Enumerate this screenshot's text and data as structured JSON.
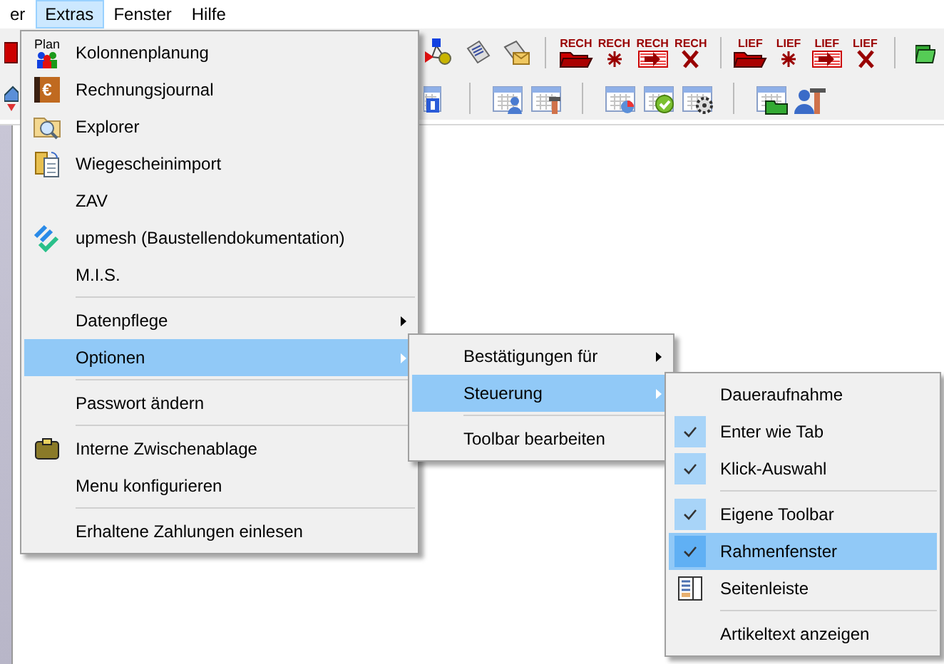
{
  "menubar": [
    {
      "label": "er",
      "selected": false
    },
    {
      "label": "Extras",
      "selected": true
    },
    {
      "label": "Fenster",
      "selected": false
    },
    {
      "label": "Hilfe",
      "selected": false
    }
  ],
  "toolbar_1": [
    {
      "kind": "red-box"
    },
    {
      "kind": "network"
    },
    {
      "kind": "document"
    },
    {
      "kind": "envelope"
    },
    {
      "kind": "separator"
    },
    {
      "kind": "folder",
      "label": "RECH"
    },
    {
      "kind": "star",
      "label": "RECH"
    },
    {
      "kind": "arrow-in",
      "label": "RECH"
    },
    {
      "kind": "cross",
      "label": "RECH"
    },
    {
      "kind": "separator"
    },
    {
      "kind": "folder",
      "label": "LIEF"
    },
    {
      "kind": "star",
      "label": "LIEF"
    },
    {
      "kind": "arrow-in",
      "label": "LIEF"
    },
    {
      "kind": "cross",
      "label": "LIEF"
    },
    {
      "kind": "separator"
    },
    {
      "kind": "green-folder"
    }
  ],
  "toolbar_2": [
    {
      "kind": "house"
    },
    {
      "kind": "calendar-p"
    },
    {
      "kind": "separator"
    },
    {
      "kind": "calendar-person"
    },
    {
      "kind": "calendar-hammer"
    },
    {
      "kind": "separator"
    },
    {
      "kind": "calendar-chart"
    },
    {
      "kind": "calendar-check"
    },
    {
      "kind": "calendar-gear"
    },
    {
      "kind": "separator"
    },
    {
      "kind": "calendar-folder"
    },
    {
      "kind": "person-hammer"
    }
  ],
  "extras_menu": [
    {
      "kind": "item",
      "label": "Kolonnenplanung",
      "icon_text": "Plan",
      "submenu": false,
      "selected": false
    },
    {
      "kind": "item",
      "label": "Rechnungsjournal",
      "icon_text": "€",
      "submenu": false,
      "selected": false
    },
    {
      "kind": "item",
      "label": "Explorer",
      "submenu": false,
      "selected": false
    },
    {
      "kind": "item",
      "label": "Wiegescheinimport",
      "submenu": false,
      "selected": false
    },
    {
      "kind": "item",
      "label": "ZAV",
      "submenu": false,
      "selected": false
    },
    {
      "kind": "item",
      "label": "upmesh (Baustellendokumentation)",
      "submenu": false,
      "selected": false
    },
    {
      "kind": "item",
      "label": "M.I.S.",
      "submenu": false,
      "selected": false
    },
    {
      "kind": "separator"
    },
    {
      "kind": "item",
      "label": "Datenpflege",
      "submenu": true,
      "selected": false
    },
    {
      "kind": "item",
      "label": "Optionen",
      "submenu": true,
      "selected": true
    },
    {
      "kind": "separator"
    },
    {
      "kind": "item",
      "label": "Passwort ändern",
      "submenu": false,
      "selected": false
    },
    {
      "kind": "separator"
    },
    {
      "kind": "item",
      "label": "Interne Zwischenablage",
      "submenu": false,
      "selected": false
    },
    {
      "kind": "item",
      "label": "Menu konfigurieren",
      "submenu": false,
      "selected": false
    },
    {
      "kind": "separator"
    },
    {
      "kind": "item",
      "label": "Erhaltene Zahlungen einlesen",
      "submenu": false,
      "selected": false
    }
  ],
  "optionen_menu": [
    {
      "kind": "item",
      "label": "Bestätigungen für",
      "submenu": true,
      "selected": false
    },
    {
      "kind": "item",
      "label": "Steuerung",
      "submenu": true,
      "selected": true
    },
    {
      "kind": "separator"
    },
    {
      "kind": "item",
      "label": "Toolbar bearbeiten",
      "submenu": false,
      "selected": false
    }
  ],
  "steuerung_menu": [
    {
      "kind": "item",
      "label": "Daueraufnahme",
      "checked": false,
      "selected": false
    },
    {
      "kind": "item",
      "label": "Enter wie Tab",
      "checked": true,
      "selected": false
    },
    {
      "kind": "item",
      "label": "Klick-Auswahl",
      "checked": true,
      "selected": false
    },
    {
      "kind": "separator"
    },
    {
      "kind": "item",
      "label": "Eigene Toolbar",
      "checked": true,
      "selected": false
    },
    {
      "kind": "item",
      "label": "Rahmenfenster",
      "checked": true,
      "selected": true
    },
    {
      "kind": "item",
      "label": "Seitenleiste",
      "checked": false,
      "selected": false
    },
    {
      "kind": "separator"
    },
    {
      "kind": "item",
      "label": "Artikeltext anzeigen",
      "checked": false,
      "selected": false
    }
  ]
}
